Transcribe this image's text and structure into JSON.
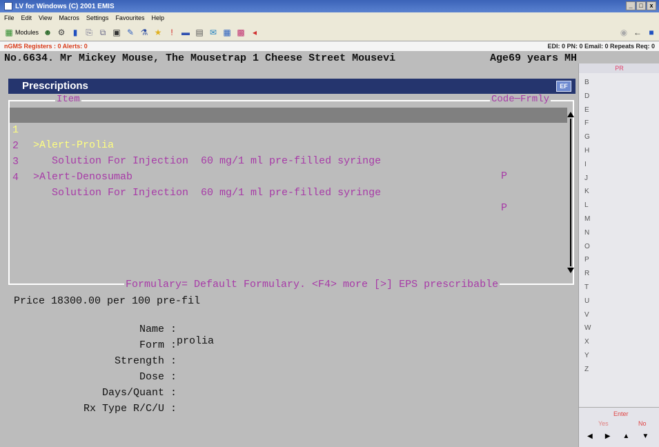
{
  "window": {
    "title": "LV for Windows (C) 2001 EMIS"
  },
  "menu": [
    "File",
    "Edit",
    "View",
    "Macros",
    "Settings",
    "Favourites",
    "Help"
  ],
  "toolbar": {
    "modules_label": "Modules"
  },
  "status": {
    "left": "nGMS Registers : 0  Alerts: 0",
    "right": "EDI: 0  PN: 0  Email: 0  Repeats Req: 0"
  },
  "patient": {
    "line": "No.6634. Mr Mickey Mouse, The Mousetrap 1 Cheese Street Mousevi",
    "age": "Age69 years MH"
  },
  "panel": {
    "title": "Prescriptions"
  },
  "list": {
    "header_item": "Item",
    "header_code": "Code─Frmly",
    "rows": [
      {
        "num": "1",
        "desc": ">Alert-Prolia",
        "code": ""
      },
      {
        "num": "2",
        "desc": "   Solution For Injection  60 mg/1 ml pre-filled syringe",
        "code": "P"
      },
      {
        "num": "3",
        "desc": ">Alert-Denosumab",
        "code": ""
      },
      {
        "num": "4",
        "desc": "   Solution For Injection  60 mg/1 ml pre-filled syringe",
        "code": "P"
      }
    ],
    "footer": "Formulary= Default Formulary. <F4> more [>] EPS prescribable"
  },
  "details": {
    "price": "Price 18300.00 per 100 pre-fil",
    "fields": [
      {
        "label": "Name :",
        "value": "prolia"
      },
      {
        "label": "Form :",
        "value": ""
      },
      {
        "label": "Strength :",
        "value": ""
      },
      {
        "label": "Dose :",
        "value": ""
      },
      {
        "label": "Days/Quant :",
        "value": ""
      },
      {
        "label": "Rx Type R/C/U :",
        "value": ""
      }
    ]
  },
  "sidebar": {
    "tab": "PR",
    "letters": [
      "B",
      "D",
      "E",
      "F",
      "G",
      "H",
      "I",
      "J",
      "K",
      "L",
      "M",
      "N",
      "O",
      "P",
      "R",
      "T",
      "U",
      "V",
      "W",
      "X",
      "Y",
      "Z"
    ]
  },
  "prompt": {
    "enter": "Enter",
    "yes": "Yes",
    "no": "No"
  }
}
